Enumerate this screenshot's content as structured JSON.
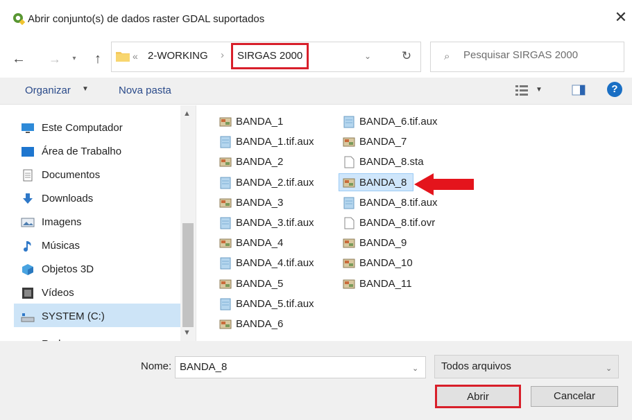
{
  "window": {
    "title": "Abrir conjunto(s) de dados raster GDAL suportados",
    "close_glyph": "✕"
  },
  "nav": {
    "back_glyph": "←",
    "forward_glyph": "→",
    "recent_glyph": "▾",
    "up_glyph": "↑",
    "breadcrumb": {
      "prefix": "«",
      "parent": "2-WORKING",
      "separator": "›",
      "current": "SIRGAS 2000"
    },
    "dropdown_glyph": "⌄",
    "refresh_glyph": "↻",
    "search_placeholder": "Pesquisar SIRGAS 2000",
    "search_glyph": "⌕"
  },
  "toolbar": {
    "organize": "Organizar",
    "organize_caret": "▼",
    "new_folder": "Nova pasta",
    "view_caret": "▼",
    "help_glyph": "?"
  },
  "sidebar": {
    "items": [
      {
        "label": "Este Computador",
        "icon": "computer-icon"
      },
      {
        "label": "Área de Trabalho",
        "icon": "desktop-icon"
      },
      {
        "label": "Documentos",
        "icon": "documents-icon"
      },
      {
        "label": "Downloads",
        "icon": "download-icon"
      },
      {
        "label": "Imagens",
        "icon": "pictures-icon"
      },
      {
        "label": "Músicas",
        "icon": "music-icon"
      },
      {
        "label": "Objetos 3D",
        "icon": "cube-icon"
      },
      {
        "label": "Vídeos",
        "icon": "video-icon"
      },
      {
        "label": "SYSTEM (C:)",
        "icon": "drive-icon"
      },
      {
        "label": "Rede",
        "icon": "network-icon"
      }
    ],
    "scroll_up": "▲",
    "scroll_down": "▼"
  },
  "files": {
    "col1": [
      {
        "name": "BANDA_1",
        "type": "raster"
      },
      {
        "name": "BANDA_1.tif.aux",
        "type": "aux"
      },
      {
        "name": "BANDA_2",
        "type": "raster"
      },
      {
        "name": "BANDA_2.tif.aux",
        "type": "aux"
      },
      {
        "name": "BANDA_3",
        "type": "raster"
      },
      {
        "name": "BANDA_3.tif.aux",
        "type": "aux"
      },
      {
        "name": "BANDA_4",
        "type": "raster"
      },
      {
        "name": "BANDA_4.tif.aux",
        "type": "aux"
      },
      {
        "name": "BANDA_5",
        "type": "raster"
      },
      {
        "name": "BANDA_5.tif.aux",
        "type": "aux"
      },
      {
        "name": "BANDA_6",
        "type": "raster"
      }
    ],
    "col2": [
      {
        "name": "BANDA_6.tif.aux",
        "type": "aux"
      },
      {
        "name": "BANDA_7",
        "type": "raster"
      },
      {
        "name": "BANDA_8.sta",
        "type": "blank"
      },
      {
        "name": "BANDA_8",
        "type": "raster"
      },
      {
        "name": "BANDA_8.tif.aux",
        "type": "aux"
      },
      {
        "name": "BANDA_8.tif.ovr",
        "type": "blank"
      },
      {
        "name": "BANDA_9",
        "type": "raster"
      },
      {
        "name": "BANDA_10",
        "type": "raster"
      },
      {
        "name": "BANDA_11",
        "type": "raster"
      }
    ]
  },
  "bottom": {
    "filename_label": "Nome:",
    "filename_value": "BANDA_8",
    "dropdown_glyph": "⌄",
    "file_type": "Todos arquivos",
    "open": "Abrir",
    "cancel": "Cancelar"
  },
  "colors": {
    "highlight_red": "#d81f2a",
    "selection_blue": "#cfe6fb",
    "accent_blue": "#1a6fc4"
  }
}
